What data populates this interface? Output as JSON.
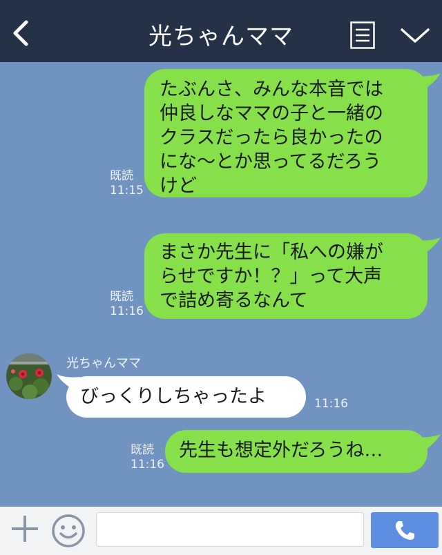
{
  "header": {
    "title": "光ちゃんママ",
    "back_icon": "chevron-left-icon",
    "menu_icon": "list-icon",
    "collapse_icon": "chevron-down-icon"
  },
  "contact": {
    "name": "光ちゃんママ"
  },
  "messages": [
    {
      "side": "me",
      "lines": [
        "たぶんさ、みんな本音では",
        "仲良しなママの子と一緒の",
        "クラスだったら良かったの",
        "にな〜とか思ってるだろう",
        "けど"
      ],
      "read": "既読",
      "time": "11:15"
    },
    {
      "side": "me",
      "lines": [
        "まさか先生に「私への嫌が",
        "らせですか！？」って大声",
        "で詰め寄るなんて"
      ],
      "read": "既読",
      "time": "11:16"
    },
    {
      "side": "them",
      "lines": [
        "びっくりしちゃったよ"
      ],
      "time": "11:16"
    },
    {
      "side": "me",
      "lines": [
        "先生も想定外だろうね…"
      ],
      "read": "既読",
      "time": "11:16"
    }
  ],
  "input": {
    "placeholder": "",
    "plus_icon": "plus-icon",
    "emoji_icon": "smiley-icon",
    "send_icon": "phone-icon"
  },
  "colors": {
    "header": "#253147",
    "chat_bg": "#7193c0",
    "my_bubble": "#87e04a",
    "their_bubble": "#ffffff",
    "send": "#5e8ee2"
  }
}
